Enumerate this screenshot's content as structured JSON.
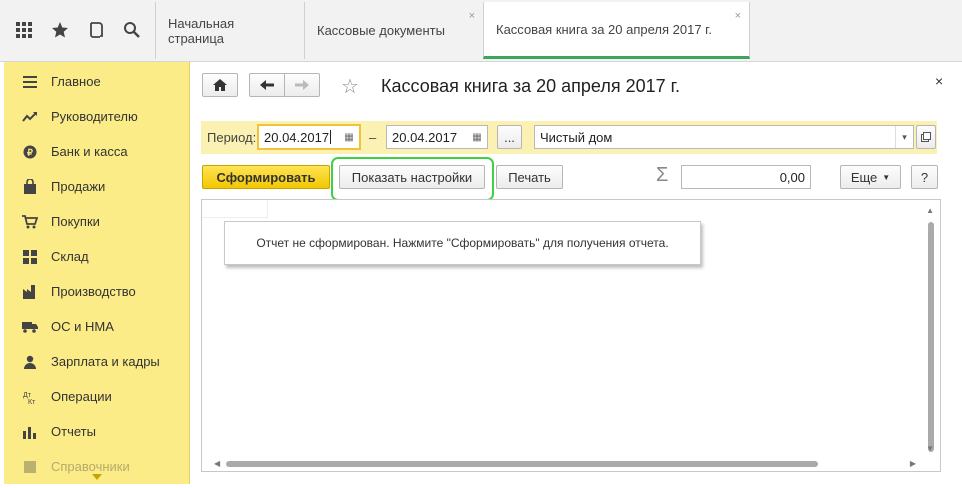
{
  "topbar": {
    "icons": [
      "apps-grid-icon",
      "favorites-star-icon",
      "history-icon",
      "search-icon"
    ],
    "tabs": [
      {
        "label": "Начальная страница",
        "closable": false,
        "active": false
      },
      {
        "label": "Кассовые документы",
        "closable": true,
        "active": false
      },
      {
        "label": "Кассовая книга за 20 апреля 2017 г.",
        "closable": true,
        "active": true
      }
    ],
    "close_glyph": "×"
  },
  "sidebar": {
    "items": [
      {
        "label": "Главное",
        "icon": "menu-lines-icon"
      },
      {
        "label": "Руководителю",
        "icon": "trend-icon"
      },
      {
        "label": "Банк и касса",
        "icon": "coin-icon"
      },
      {
        "label": "Продажи",
        "icon": "bag-icon"
      },
      {
        "label": "Покупки",
        "icon": "cart-icon"
      },
      {
        "label": "Склад",
        "icon": "warehouse-icon"
      },
      {
        "label": "Производство",
        "icon": "factory-icon"
      },
      {
        "label": "ОС и НМА",
        "icon": "truck-icon"
      },
      {
        "label": "Зарплата и кадры",
        "icon": "people-icon"
      },
      {
        "label": "Операции",
        "icon": "dt-kt-icon"
      },
      {
        "label": "Отчеты",
        "icon": "bar-chart-icon"
      },
      {
        "label": "Справочники",
        "icon": "book-icon"
      }
    ]
  },
  "form": {
    "title": "Кассовая книга за 20 апреля 2017 г.",
    "period_label": "Период:",
    "date_from": "20.04.2017",
    "dash": "–",
    "date_to": "20.04.2017",
    "ellipsis": "...",
    "organization": "Чистый дом",
    "generate_label": "Сформировать",
    "settings_label": "Показать настройки",
    "print_label": "Печать",
    "sum_glyph": "Σ",
    "sum_value": "0,00",
    "more_label": "Еще",
    "help_label": "?",
    "message": "Отчет не сформирован. Нажмите \"Сформировать\" для получения отчета."
  },
  "colors": {
    "sidebar_bg": "#fbec88",
    "period_bar_bg": "#fbf1b3",
    "generate_btn": "#f7d42a",
    "active_tab_accent": "#3da55a",
    "highlight_outline": "#3fd23f"
  }
}
